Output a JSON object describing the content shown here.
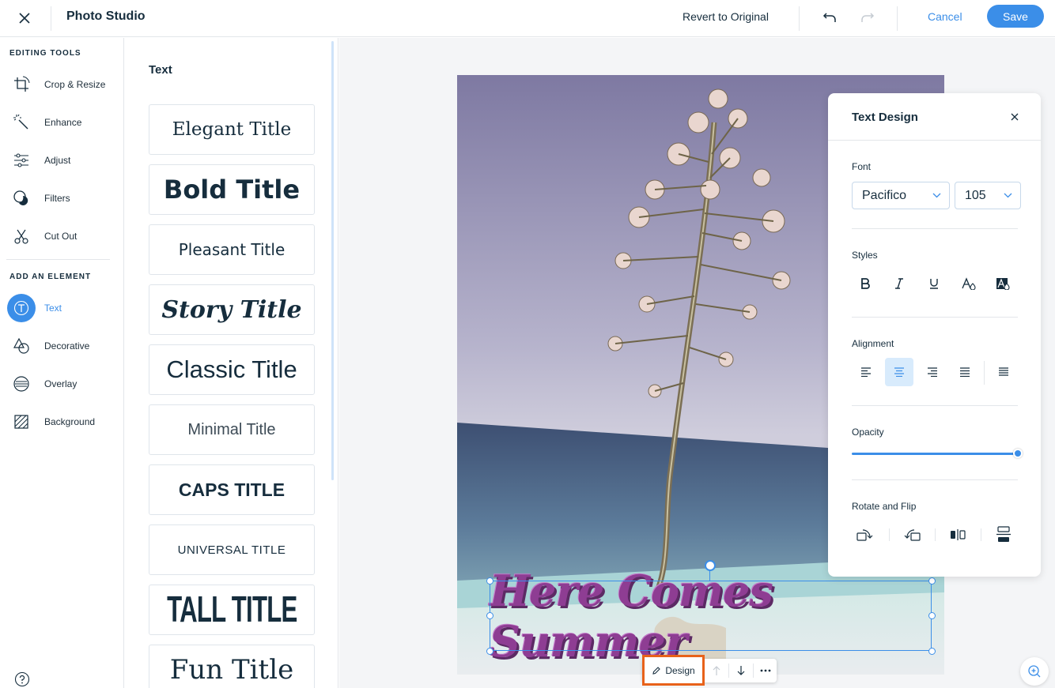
{
  "app": {
    "title": "Photo Studio",
    "revert_label": "Revert to Original",
    "cancel_label": "Cancel",
    "save_label": "Save"
  },
  "sidebar": {
    "editing_heading": "EDITING TOOLS",
    "editing_items": [
      {
        "label": "Crop & Resize",
        "icon": "crop-icon"
      },
      {
        "label": "Enhance",
        "icon": "magic-wand-icon"
      },
      {
        "label": "Adjust",
        "icon": "sliders-icon"
      },
      {
        "label": "Filters",
        "icon": "filters-icon"
      },
      {
        "label": "Cut Out",
        "icon": "scissors-icon"
      }
    ],
    "element_heading": "ADD AN ELEMENT",
    "element_items": [
      {
        "label": "Text",
        "icon": "text-icon",
        "active": true
      },
      {
        "label": "Decorative",
        "icon": "shapes-icon"
      },
      {
        "label": "Overlay",
        "icon": "overlay-icon"
      },
      {
        "label": "Background",
        "icon": "background-icon"
      }
    ]
  },
  "text_panel": {
    "title": "Text",
    "presets": [
      "Elegant Title",
      "Bold Title",
      "Pleasant Title",
      "Story Title",
      "Classic Title",
      "Minimal Title",
      "CAPS TITLE",
      "UNIVERSAL TITLE",
      "TALL TITLE",
      "Fun Title"
    ]
  },
  "canvas": {
    "overlay_text": "Here Comes Summer",
    "text_color": "#8e3d93",
    "context_menu": {
      "design_label": "Design"
    }
  },
  "design_panel": {
    "title": "Text Design",
    "font_label": "Font",
    "font_value": "Pacifico",
    "size_value": "105",
    "styles_label": "Styles",
    "alignment_label": "Alignment",
    "alignment_selected": "center",
    "opacity_label": "Opacity",
    "opacity_value": 100,
    "rotate_label": "Rotate and Flip"
  },
  "colors": {
    "accent": "#3b8ee8",
    "highlight": "#e8621a",
    "text_dark": "#162d3d"
  }
}
